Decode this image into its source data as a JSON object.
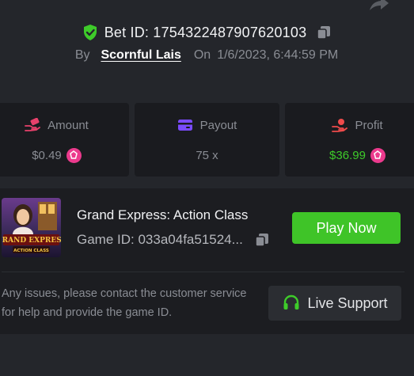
{
  "header": {
    "bet_id_label": "Bet ID: 1754322487907620103",
    "by_label": "By",
    "username": "Scornful Lais",
    "on_label": "On",
    "date": "1/6/2023, 6:44:59 PM"
  },
  "stats": {
    "amount": {
      "label": "Amount",
      "value": "$0.49"
    },
    "payout": {
      "label": "Payout",
      "value": "75 x"
    },
    "profit": {
      "label": "Profit",
      "value": "$36.99"
    }
  },
  "game": {
    "title": "Grand Express: Action Class",
    "game_id": "Game ID: 033a04fa51524...",
    "play_label": "Play Now",
    "thumb_logo_line1": "GRAND EXPRESS",
    "thumb_logo_line2": "ACTION CLASS"
  },
  "support": {
    "note": "Any issues, please contact the customer service for help and provide the game ID.",
    "button_label": "Live Support"
  },
  "colors": {
    "background": "#24262b",
    "panel": "#1a1b1f",
    "accent_green": "#3fc428",
    "profit_green": "#3ecb2a",
    "coin_pink": "#ec3a8d",
    "amount_icon": "#e8416b",
    "payout_icon": "#7b4bff",
    "profit_icon": "#ef4b4b"
  },
  "icons": {
    "share": "share-arrow-icon",
    "verified": "shield-check-icon",
    "copy": "copy-icon",
    "amount": "money-hand-icon",
    "payout": "card-icon",
    "profit": "profit-hand-icon",
    "coin": "coin-icon",
    "support": "headset-icon"
  }
}
